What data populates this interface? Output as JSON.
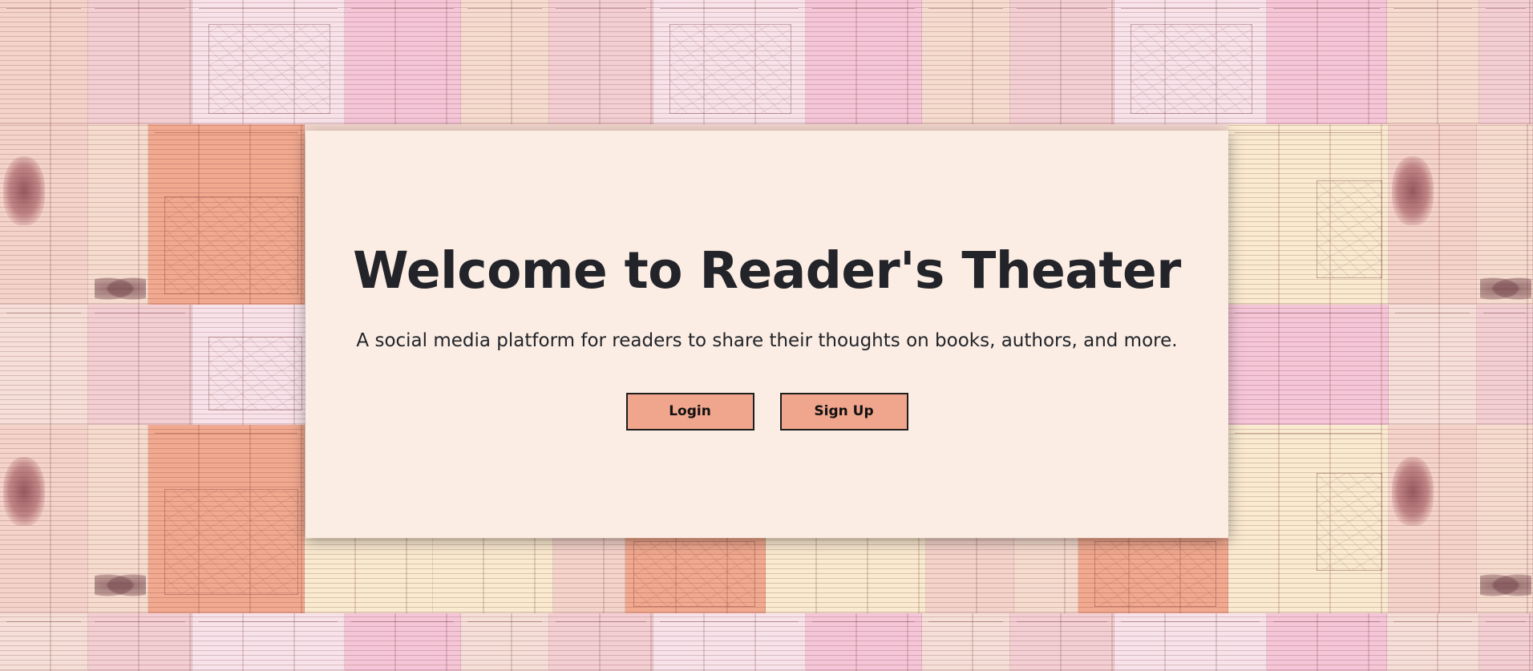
{
  "hero": {
    "title": "Welcome to Reader's Theater",
    "subtitle": "A social media platform for readers to share their thoughts on books, authors, and more.",
    "login_label": "Login",
    "signup_label": "Sign Up"
  },
  "theme": {
    "card_background": "#fbede3",
    "button_color": "#f0a58d",
    "text_color": "#22242a"
  },
  "background": {
    "description_icon": "vintage-encyclopedia-pages-collage"
  }
}
